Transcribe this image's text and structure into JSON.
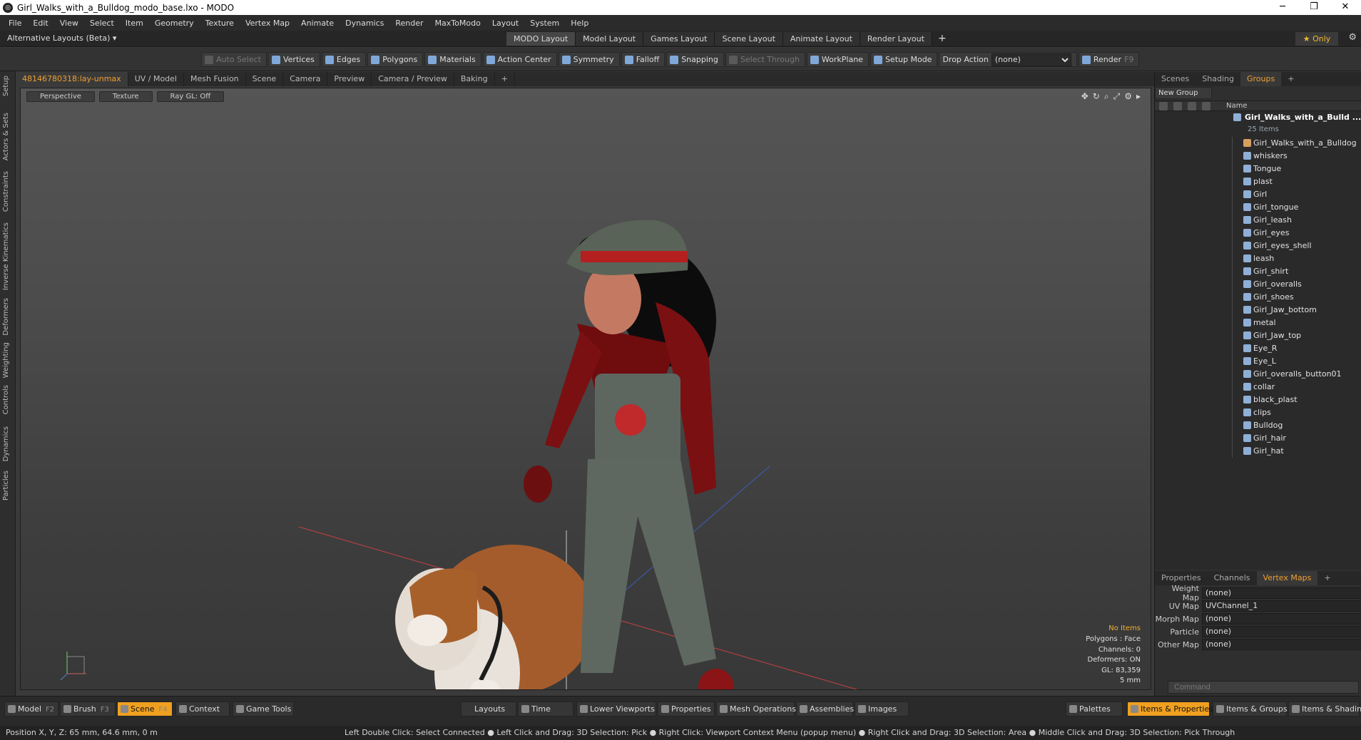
{
  "window": {
    "title": "Girl_Walks_with_a_Bulldog_modo_base.lxo - MODO"
  },
  "menu": [
    "File",
    "Edit",
    "View",
    "Select",
    "Item",
    "Geometry",
    "Texture",
    "Vertex Map",
    "Animate",
    "Dynamics",
    "Render",
    "MaxToModo",
    "Layout",
    "System",
    "Help"
  ],
  "layoutbar": {
    "alt_layouts": "Alternative Layouts (Beta) ▾",
    "tabs": [
      "MODO Layout",
      "Model Layout",
      "Games Layout",
      "Scene Layout",
      "Animate Layout",
      "Render Layout"
    ],
    "only": "★  Only"
  },
  "toolbar": {
    "auto_select": "Auto Select",
    "vertices": "Vertices",
    "edges": "Edges",
    "polygons": "Polygons",
    "materials": "Materials",
    "action_center": "Action Center",
    "symmetry": "Symmetry",
    "falloff": "Falloff",
    "snapping": "Snapping",
    "select_through": "Select Through",
    "workplane": "WorkPlane",
    "setup_mode": "Setup Mode",
    "drop_action": "Drop Action",
    "drop_value": "(none)",
    "render": "Render",
    "render_key": "F9"
  },
  "left_tabs": [
    "Setup",
    "Actors & Sets",
    "Constraints",
    "Inverse Kinematics",
    "Deformers",
    "Weighting",
    "Controls",
    "Dynamics",
    "Particles"
  ],
  "viewport_tabs": [
    "48146780318:lay-unmax",
    "UV / Model",
    "Mesh Fusion",
    "Scene",
    "Camera",
    "Preview",
    "Camera / Preview",
    "Baking"
  ],
  "viewport": {
    "view": "Perspective",
    "shading": "Texture",
    "raygl": "Ray GL: Off",
    "stats": {
      "no_items": "No Items",
      "polygons": "Polygons : Face",
      "channels": "Channels: 0",
      "deformers": "Deformers: ON",
      "gl": "GL: 83,359",
      "scale": "5 mm"
    }
  },
  "right_panel": {
    "top_tabs": [
      "Scenes",
      "Shading",
      "Groups"
    ],
    "new_group": "New Group",
    "name_header": "Name",
    "group_title": "Girl_Walks_with_a_Bulld ...",
    "group_count": "25 Items",
    "items": [
      "Girl_Walks_with_a_Bulldog",
      "whiskers",
      "Tongue",
      "plast",
      "Girl",
      "Girl_tongue",
      "Girl_leash",
      "Girl_eyes",
      "Girl_eyes_shell",
      "leash",
      "Girl_shirt",
      "Girl_overalls",
      "Girl_shoes",
      "Girl_Jaw_bottom",
      "metal",
      "Girl_Jaw_top",
      "Eye_R",
      "Eye_L",
      "Girl_overalls_button01",
      "collar",
      "black_plast",
      "clips",
      "Bulldog",
      "Girl_hair",
      "Girl_hat"
    ],
    "bottom_tabs": [
      "Properties",
      "Channels",
      "Vertex Maps"
    ],
    "vertex_maps": [
      {
        "k": "Weight Map",
        "v": "(none)"
      },
      {
        "k": "UV Map",
        "v": "UVChannel_1"
      },
      {
        "k": "Morph Map",
        "v": "(none)"
      },
      {
        "k": "Particle",
        "v": "(none)"
      },
      {
        "k": "Other Map",
        "v": "(none)"
      }
    ],
    "command_placeholder": "Command"
  },
  "bottom": {
    "model": "Model",
    "model_key": "F2",
    "brush": "Brush",
    "brush_key": "F3",
    "scene": "Scene",
    "scene_key": "F4",
    "context": "Context",
    "game_tools": "Game Tools",
    "layouts": "Layouts",
    "time": "Time",
    "lower_viewports": "Lower Viewports",
    "properties": "Properties",
    "mesh_operations": "Mesh Operations",
    "assemblies": "Assemblies",
    "images": "Images",
    "palettes": "Palettes",
    "items_properties": "Items & Properties",
    "items_groups": "Items & Groups",
    "items_shading": "Items & Shading"
  },
  "status": {
    "position": "Position X, Y, Z:  65 mm, 64.6 mm, 0 m",
    "hint": "Left Double Click: Select Connected ● Left Click and Drag: 3D Selection: Pick ● Right Click: Viewport Context Menu (popup menu) ● Right Click and Drag: 3D Selection: Area ● Middle Click and Drag: 3D Selection: Pick Through"
  },
  "colors": {
    "accent": "#f0a020",
    "viewport_top": "#555555",
    "viewport_bottom": "#383838"
  }
}
